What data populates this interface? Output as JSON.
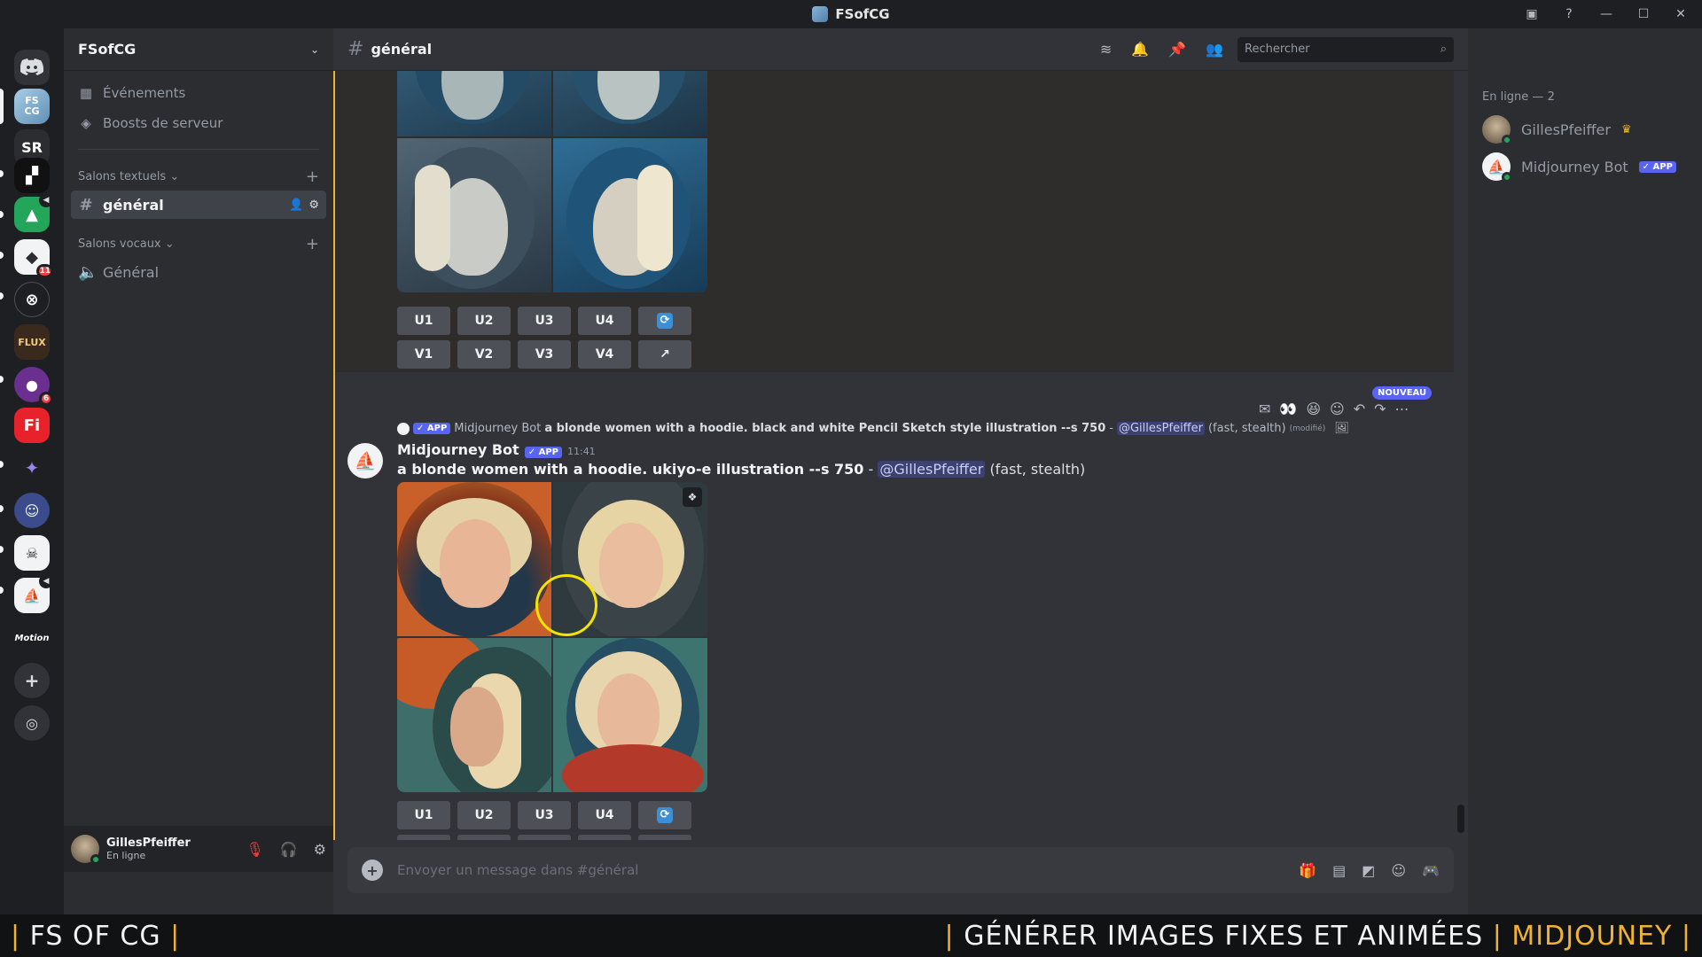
{
  "window": {
    "title": "FSofCG"
  },
  "rail": {
    "servers": [
      {
        "name": "FS CG",
        "label": "FS\nCG"
      },
      {
        "name": "SR",
        "label": "SR"
      },
      {
        "name": "server-3",
        "label": ""
      },
      {
        "name": "server-4",
        "label": ""
      },
      {
        "name": "server-5",
        "label": "",
        "badge": "11"
      },
      {
        "name": "server-6",
        "label": ""
      },
      {
        "name": "FLUX",
        "label": "FLUX"
      },
      {
        "name": "server-8",
        "label": "",
        "badge": "6"
      },
      {
        "name": "Fi",
        "label": "Fi"
      },
      {
        "name": "server-10",
        "label": ""
      },
      {
        "name": "server-11",
        "label": ""
      },
      {
        "name": "server-12",
        "label": ""
      },
      {
        "name": "server-13",
        "label": ""
      },
      {
        "name": "Motion",
        "label": "Motion"
      }
    ]
  },
  "sidebar": {
    "server_name": "FSofCG",
    "events_label": "Événements",
    "boosts_label": "Boosts de serveur",
    "text_category": "Salons textuels",
    "voice_category": "Salons vocaux",
    "text_channel": "général",
    "voice_channel": "Général"
  },
  "user": {
    "name": "GillesPfeiffer",
    "status": "En ligne"
  },
  "channel": {
    "name": "général",
    "search_placeholder": "Rechercher"
  },
  "buttons": {
    "upscale": [
      "U1",
      "U2",
      "U3",
      "U4"
    ],
    "variation": [
      "V1",
      "V2",
      "V3",
      "V4"
    ]
  },
  "reply": {
    "app_tag": "APP",
    "author": "Midjourney Bot",
    "prompt": "a blonde women with a hoodie. black and white Pencil Sketch style illustration --s 750",
    "dash": "-",
    "mention": "@GillesPfeiffer",
    "suffix": "(fast, stealth)",
    "edited": "(modifié)"
  },
  "message": {
    "author": "Midjourney Bot",
    "app_tag": "APP",
    "time": "11:41",
    "prompt": "a blonde women with a hoodie. ukiyo-e illustration --s 750",
    "dash": "-",
    "mention": "@GillesPfeiffer",
    "suffix": "(fast, stealth)"
  },
  "new_badge": "NOUVEAU",
  "composer": {
    "placeholder": "Envoyer un message dans #général"
  },
  "members": {
    "header": "En ligne — 2",
    "list": [
      {
        "name": "GillesPfeiffer"
      },
      {
        "name": "Midjourney Bot",
        "tag": "APP"
      }
    ]
  },
  "banner": {
    "left": "FS OF CG",
    "right_main": "GÉNÉRER IMAGES FIXES ET ANIMÉES",
    "right_accent": "MIDJOUNEY"
  },
  "colors": {
    "accent": "#f0b232",
    "blurple": "#5865f2",
    "online": "#23a55a"
  }
}
